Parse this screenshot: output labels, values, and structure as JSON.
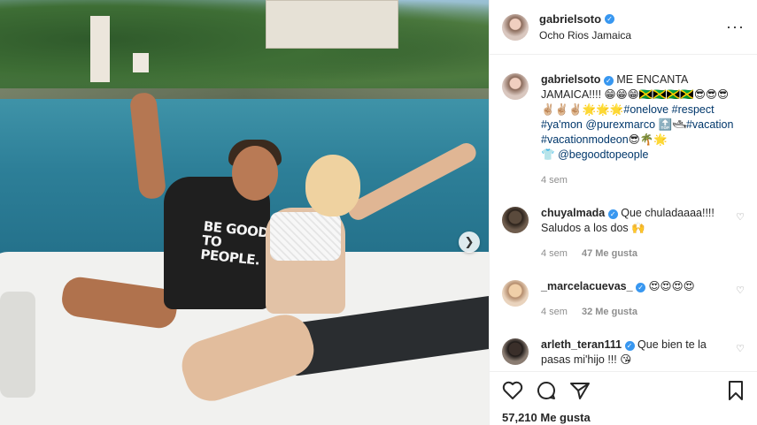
{
  "post": {
    "username": "gabrielsoto",
    "location": "Ocho Rios Jamaica",
    "more_icon": "more-dots-icon"
  },
  "photo": {
    "shirt_text": "BE GOOD TO PEOPLE.",
    "next_icon": "chevron-right-icon"
  },
  "caption": {
    "username": "gabrielsoto",
    "line1": "ME ENCANTA JAMAICA!!!! 😁😁😁🇯🇲🇯🇲🇯🇲🇯🇲😎😎😎",
    "line2_prefix": "✌🏼✌🏼✌🏼🌟🌟🌟",
    "hashtag_onelove": "#onelove",
    "hashtag_respect": "#respect",
    "hashtag_yamon": "#ya'mon",
    "mention_purexmarco": "@purexmarco",
    "emoji_mid": "🔝🛥",
    "hashtag_vacation": "#vacation",
    "hashtag_vacationmodeon": "#vacationmodeon",
    "emoji_end": "😎🌴🌟",
    "emoji_shirt": "👕",
    "mention_begood": "@begoodtopeople",
    "time": "4 sem"
  },
  "comments": [
    {
      "username": "chuyalmada",
      "verified": true,
      "text": "Que chuladaaaa!!!! Saludos a los dos 🙌",
      "time": "4 sem",
      "likes": "47 Me gusta"
    },
    {
      "username": "_marcelacuevas_",
      "verified": true,
      "text": "😍😍😍😍",
      "time": "4 sem",
      "likes": "32 Me gusta"
    },
    {
      "username": "arleth_teran111",
      "verified": true,
      "text": "Que bien te la pasas mi'hijo !!! 😘",
      "time": "",
      "likes": ""
    }
  ],
  "footer": {
    "likes": "57,210 Me gusta",
    "icons": [
      "heart-icon",
      "comment-icon",
      "share-icon",
      "bookmark-icon"
    ]
  }
}
